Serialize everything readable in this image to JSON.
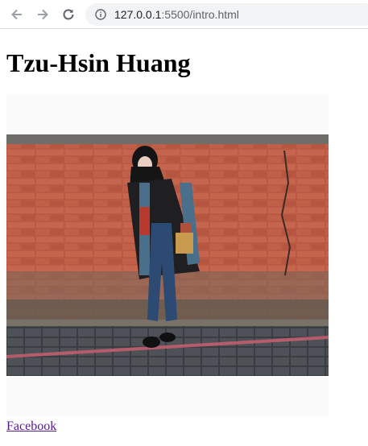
{
  "browser": {
    "url_host": "127.0.0.1",
    "url_rest": ":5500/intro.html",
    "back_icon": "arrow-left-icon",
    "forward_icon": "arrow-right-icon",
    "reload_icon": "reload-icon",
    "site_info_icon": "info-icon"
  },
  "page": {
    "title": "Tzu-Hsin Huang",
    "photo_alt": "Portrait photo of a woman leaning against a red brick wall",
    "link_label": "Facebook"
  },
  "colors": {
    "link_visited": "#551a8b",
    "toolbar_bg": "#ffffff",
    "omnibox_bg": "#f1f3f4"
  }
}
